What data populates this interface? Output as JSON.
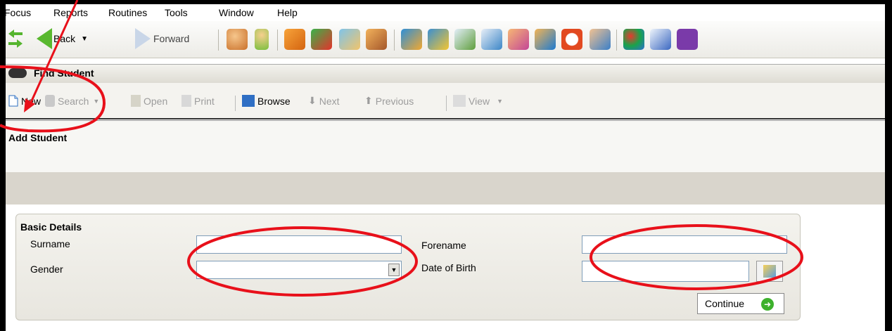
{
  "menu": {
    "items": [
      {
        "label": "Focus",
        "accel": "F"
      },
      {
        "label": "Reports",
        "accel": "R"
      },
      {
        "label": "Routines",
        "accel": "o"
      },
      {
        "label": "Tools",
        "accel": "T"
      },
      {
        "label": "Window",
        "accel": "W"
      },
      {
        "label": "Help",
        "accel": "H"
      }
    ]
  },
  "toolbar": {
    "back_label": "Back",
    "forward_label": "Forward"
  },
  "find": {
    "title": "Find Student",
    "commands": {
      "new": "New",
      "search": "Search",
      "open": "Open",
      "print": "Print",
      "browse": "Browse",
      "next": "Next",
      "previous": "Previous",
      "view": "View"
    }
  },
  "add": {
    "title": "Add Student"
  },
  "basic": {
    "title": "Basic Details",
    "surname_label": "Surname",
    "forename_label": "Forename",
    "gender_label": "Gender",
    "dob_label": "Date of Birth",
    "surname_value": "",
    "forename_value": "",
    "gender_value": "",
    "dob_value": "",
    "continue_label": "Continue"
  },
  "colors": {
    "annotation": "#e8101a",
    "toolbar_bg": "#ecebe6",
    "band": "#d9d5cc"
  }
}
